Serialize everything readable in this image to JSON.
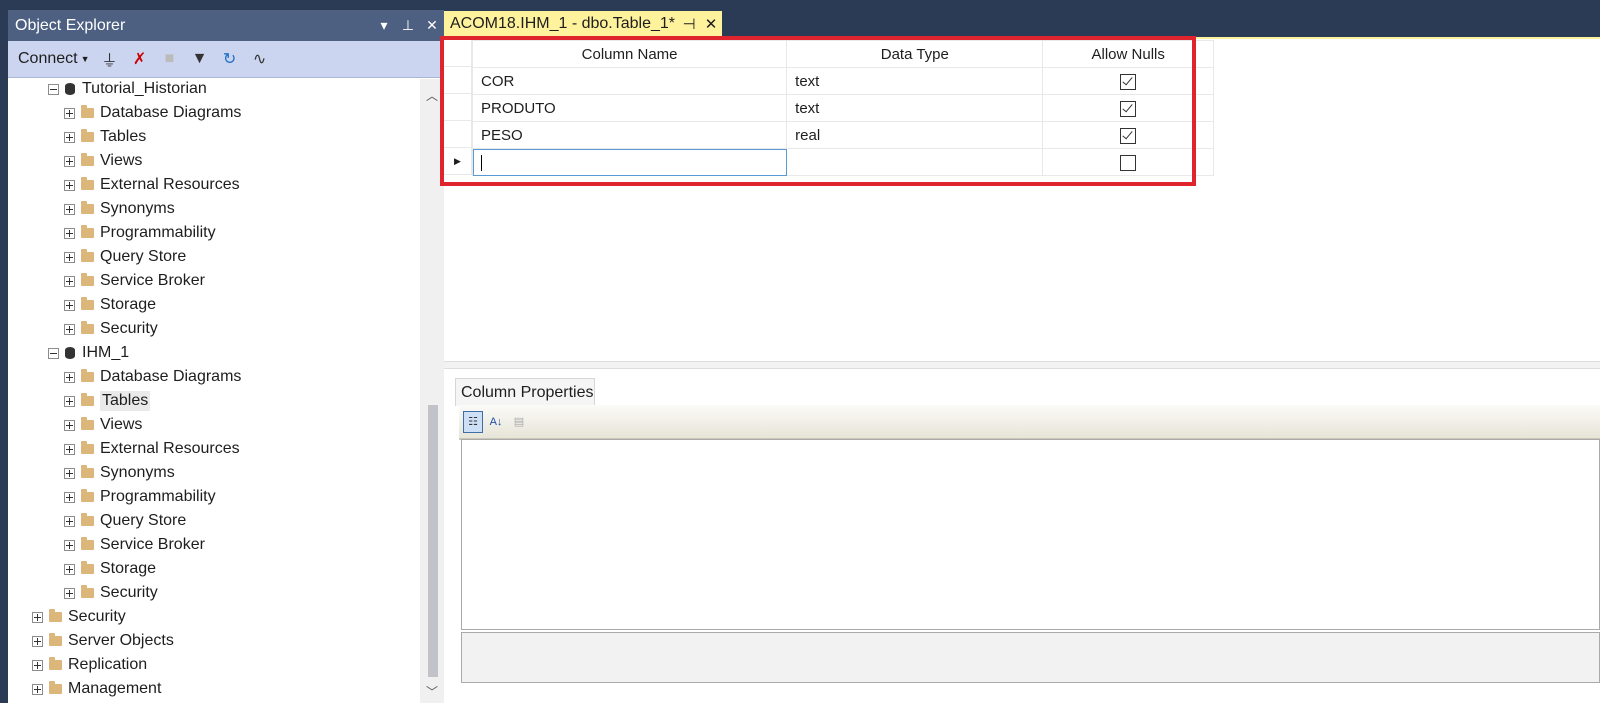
{
  "object_explorer": {
    "title": "Object Explorer",
    "connect_label": "Connect",
    "databases": [
      {
        "name": "Tutorial_Historian",
        "folders": [
          "Database Diagrams",
          "Tables",
          "Views",
          "External Resources",
          "Synonyms",
          "Programmability",
          "Query Store",
          "Service Broker",
          "Storage",
          "Security"
        ]
      },
      {
        "name": "IHM_1",
        "folders": [
          "Database Diagrams",
          "Tables",
          "Views",
          "External Resources",
          "Synonyms",
          "Programmability",
          "Query Store",
          "Service Broker",
          "Storage",
          "Security"
        ],
        "selected_folder": "Tables"
      }
    ],
    "server_nodes": [
      "Security",
      "Server Objects",
      "Replication",
      "Management"
    ]
  },
  "document_tab": {
    "title": "ACOM18.IHM_1 - dbo.Table_1*"
  },
  "designer": {
    "columns": [
      "Column Name",
      "Data Type",
      "Allow Nulls"
    ],
    "rows": [
      {
        "name": "COR",
        "type": "text",
        "allow_nulls": true
      },
      {
        "name": "PRODUTO",
        "type": "text",
        "allow_nulls": true
      },
      {
        "name": "PESO",
        "type": "real",
        "allow_nulls": true
      },
      {
        "name": "",
        "type": "",
        "allow_nulls": false
      }
    ]
  },
  "column_properties": {
    "tab_label": "Column Properties"
  },
  "colors": {
    "title_bar": "#4d6082",
    "toolbar": "#ccd5f0",
    "tab_yellow": "#fff29d",
    "highlight_red": "#e0242d"
  }
}
